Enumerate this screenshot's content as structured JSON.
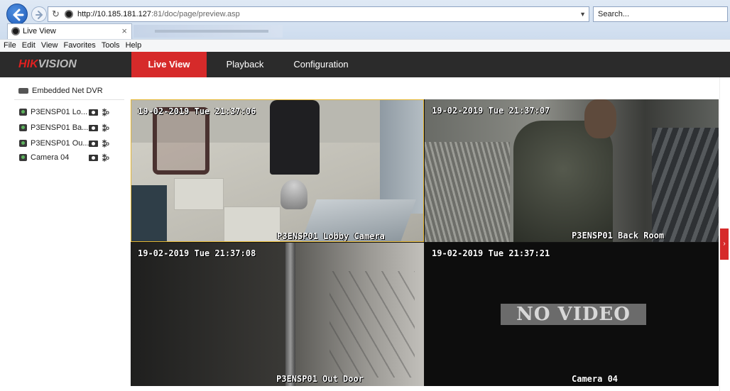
{
  "browser": {
    "url_host": "http://10.185.181.127",
    "url_path": ":81/doc/page/preview.asp",
    "search_placeholder": "Search...",
    "tab_title": "Live View",
    "menu": [
      "File",
      "Edit",
      "View",
      "Favorites",
      "Tools",
      "Help"
    ]
  },
  "app": {
    "logo": "HIKVISION",
    "nav": {
      "live_view": "Live View",
      "playback": "Playback",
      "configuration": "Configuration"
    },
    "accent_color": "#d62a2a"
  },
  "sidebar": {
    "device_name": "Embedded Net DVR",
    "cameras": [
      {
        "label": "P3ENSP01 Lo..."
      },
      {
        "label": "P3ENSP01 Ba..."
      },
      {
        "label": "P3ENSP01 Ou..."
      },
      {
        "label": "Camera 04"
      }
    ]
  },
  "tiles": [
    {
      "timestamp": "19-02-2019 Tue 21:37:06",
      "name": "P3ENSP01 Lobby Camera",
      "selected": true
    },
    {
      "timestamp": "19-02-2019 Tue 21:37:07",
      "name": "P3ENSP01 Back Room"
    },
    {
      "timestamp": "19-02-2019 Tue 21:37:08",
      "name": "P3ENSP01 Out Door"
    },
    {
      "timestamp": "19-02-2019 Tue 21:37:21",
      "name": "Camera 04",
      "no_video": "NO VIDEO"
    }
  ]
}
